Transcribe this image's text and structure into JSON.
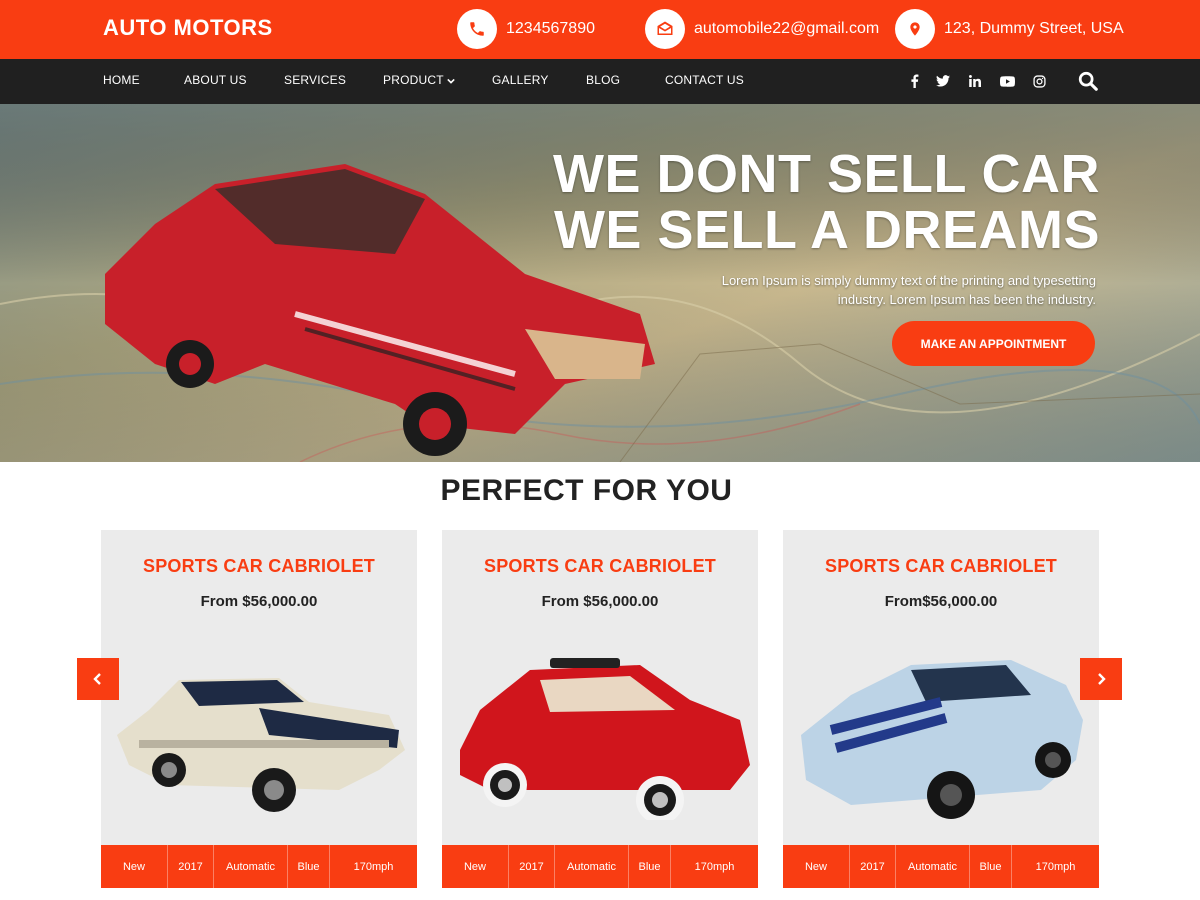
{
  "header": {
    "brand": "AUTO MOTORS",
    "phone": "1234567890",
    "email": "automobile22@gmail.com",
    "address": "123, Dummy Street, USA"
  },
  "nav": {
    "items": [
      "HOME",
      "ABOUT US",
      "SERVICES",
      "PRODUCT",
      "GALLERY",
      "BLOG",
      "CONTACT US"
    ],
    "social_icons": [
      "facebook-icon",
      "twitter-icon",
      "linkedin-icon",
      "youtube-icon",
      "instagram-icon"
    ]
  },
  "hero": {
    "title_line1": "WE DONT SELL CAR",
    "title_line2": "WE SELL A DREAMS",
    "text_line1": "Lorem Ipsum is simply dummy text of the printing and typesetting",
    "text_line2": "industry. Lorem Ipsum has been the industry.",
    "cta": "MAKE AN APPOINTMENT"
  },
  "section": {
    "title": "PERFECT FOR YOU"
  },
  "cards": [
    {
      "title": "SPORTS CAR CABRIOLET",
      "price": "From $56,000.00",
      "specs": [
        "New",
        "2017",
        "Automatic",
        "Blue",
        "170mph"
      ]
    },
    {
      "title": "SPORTS CAR CABRIOLET",
      "price": "From $56,000.00",
      "specs": [
        "New",
        "2017",
        "Automatic",
        "Blue",
        "170mph"
      ]
    },
    {
      "title": "SPORTS CAR CABRIOLET",
      "price": "From$56,000.00",
      "specs": [
        "New",
        "2017",
        "Automatic",
        "Blue",
        "170mph"
      ]
    }
  ],
  "colors": {
    "accent": "#f93d12",
    "nav_bg": "#202020",
    "card_bg": "#ebebeb"
  }
}
